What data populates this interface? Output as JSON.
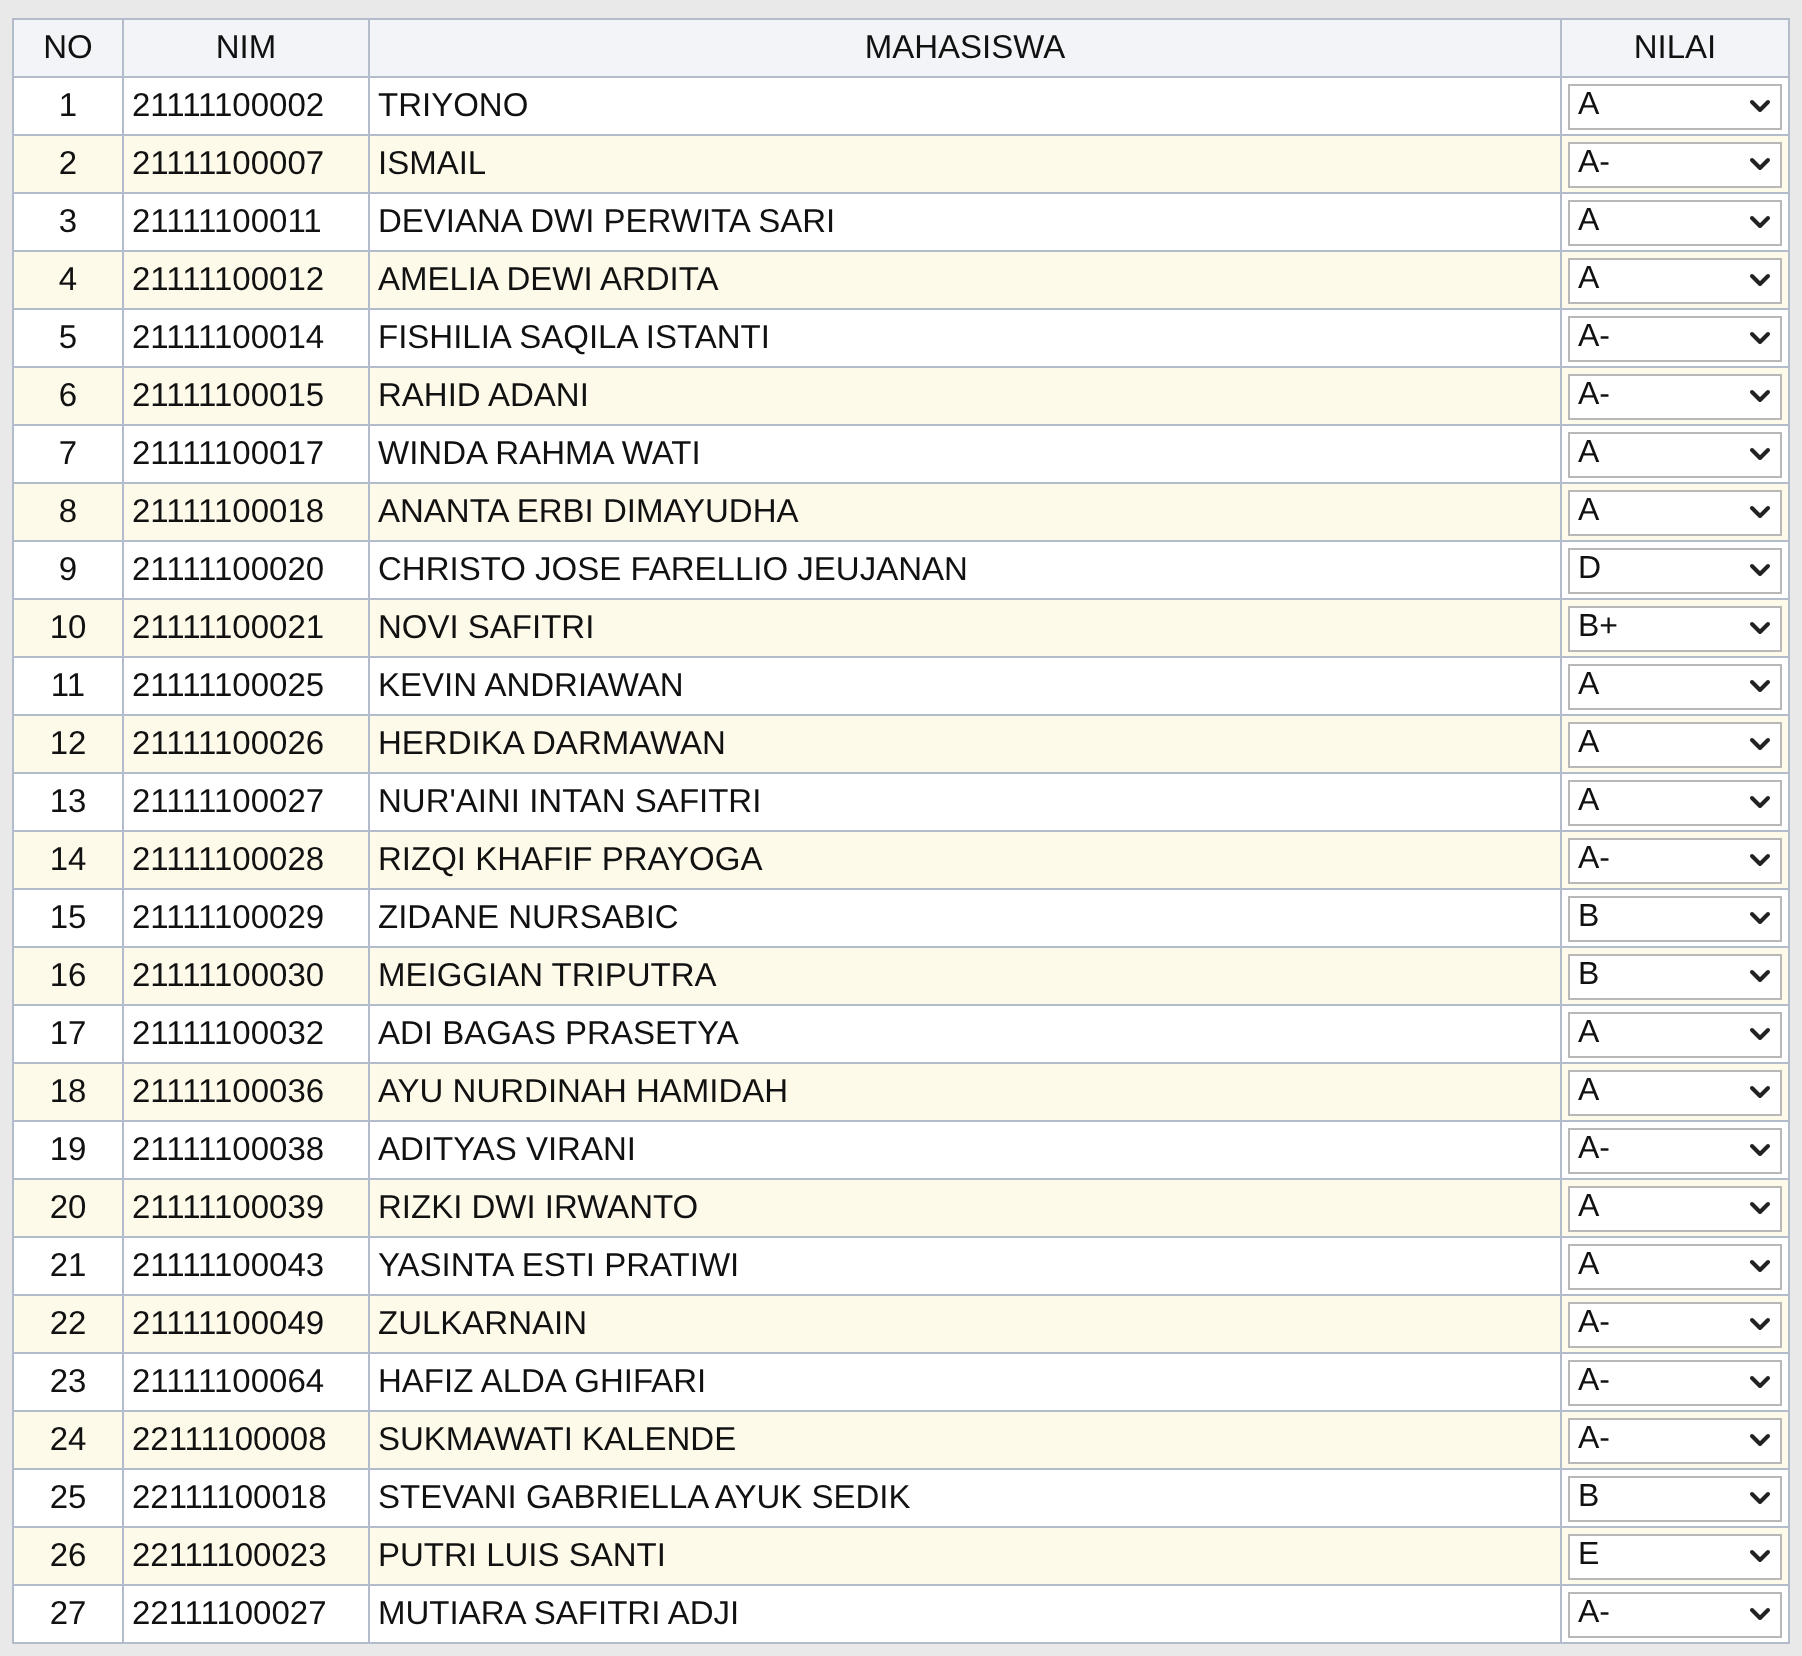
{
  "table": {
    "columns": [
      "NO",
      "NIM",
      "MAHASISWA",
      "NILAI"
    ],
    "rows": [
      {
        "no": "1",
        "nim": "21111100002",
        "name": "TRIYONO",
        "grade": "A"
      },
      {
        "no": "2",
        "nim": "21111100007",
        "name": "ISMAIL",
        "grade": "A-"
      },
      {
        "no": "3",
        "nim": "21111100011",
        "name": "DEVIANA DWI PERWITA SARI",
        "grade": "A"
      },
      {
        "no": "4",
        "nim": "21111100012",
        "name": "AMELIA DEWI ARDITA",
        "grade": "A"
      },
      {
        "no": "5",
        "nim": "21111100014",
        "name": "FISHILIA SAQILA ISTANTI",
        "grade": "A-"
      },
      {
        "no": "6",
        "nim": "21111100015",
        "name": "RAHID ADANI",
        "grade": "A-"
      },
      {
        "no": "7",
        "nim": "21111100017",
        "name": "WINDA RAHMA WATI",
        "grade": "A"
      },
      {
        "no": "8",
        "nim": "21111100018",
        "name": "ANANTA ERBI DIMAYUDHA",
        "grade": "A"
      },
      {
        "no": "9",
        "nim": "21111100020",
        "name": "CHRISTO JOSE FARELLIO JEUJANAN",
        "grade": "D"
      },
      {
        "no": "10",
        "nim": "21111100021",
        "name": "NOVI SAFITRI",
        "grade": "B+"
      },
      {
        "no": "11",
        "nim": "21111100025",
        "name": "KEVIN ANDRIAWAN",
        "grade": "A"
      },
      {
        "no": "12",
        "nim": "21111100026",
        "name": "HERDIKA DARMAWAN",
        "grade": "A"
      },
      {
        "no": "13",
        "nim": "21111100027",
        "name": "NUR'AINI INTAN SAFITRI",
        "grade": "A"
      },
      {
        "no": "14",
        "nim": "21111100028",
        "name": "RIZQI KHAFIF PRAYOGA",
        "grade": "A-"
      },
      {
        "no": "15",
        "nim": "21111100029",
        "name": "ZIDANE NURSABIC",
        "grade": "B"
      },
      {
        "no": "16",
        "nim": "21111100030",
        "name": "MEIGGIAN TRIPUTRA",
        "grade": "B"
      },
      {
        "no": "17",
        "nim": "21111100032",
        "name": "ADI BAGAS PRASETYA",
        "grade": "A"
      },
      {
        "no": "18",
        "nim": "21111100036",
        "name": "AYU NURDINAH HAMIDAH",
        "grade": "A"
      },
      {
        "no": "19",
        "nim": "21111100038",
        "name": "ADITYAS VIRANI",
        "grade": "A-"
      },
      {
        "no": "20",
        "nim": "21111100039",
        "name": "RIZKI DWI IRWANTO",
        "grade": "A"
      },
      {
        "no": "21",
        "nim": "21111100043",
        "name": "YASINTA ESTI PRATIWI",
        "grade": "A"
      },
      {
        "no": "22",
        "nim": "21111100049",
        "name": "ZULKARNAIN",
        "grade": "A-"
      },
      {
        "no": "23",
        "nim": "21111100064",
        "name": "HAFIZ ALDA GHIFARI",
        "grade": "A-"
      },
      {
        "no": "24",
        "nim": "22111100008",
        "name": "SUKMAWATI KALENDE",
        "grade": "A-"
      },
      {
        "no": "25",
        "nim": "22111100018",
        "name": "STEVANI GABRIELLA AYUK SEDIK",
        "grade": "B"
      },
      {
        "no": "26",
        "nim": "22111100023",
        "name": "PUTRI LUIS SANTI",
        "grade": "E"
      },
      {
        "no": "27",
        "nim": "22111100027",
        "name": "MUTIARA SAFITRI ADJI",
        "grade": "A-"
      }
    ]
  }
}
